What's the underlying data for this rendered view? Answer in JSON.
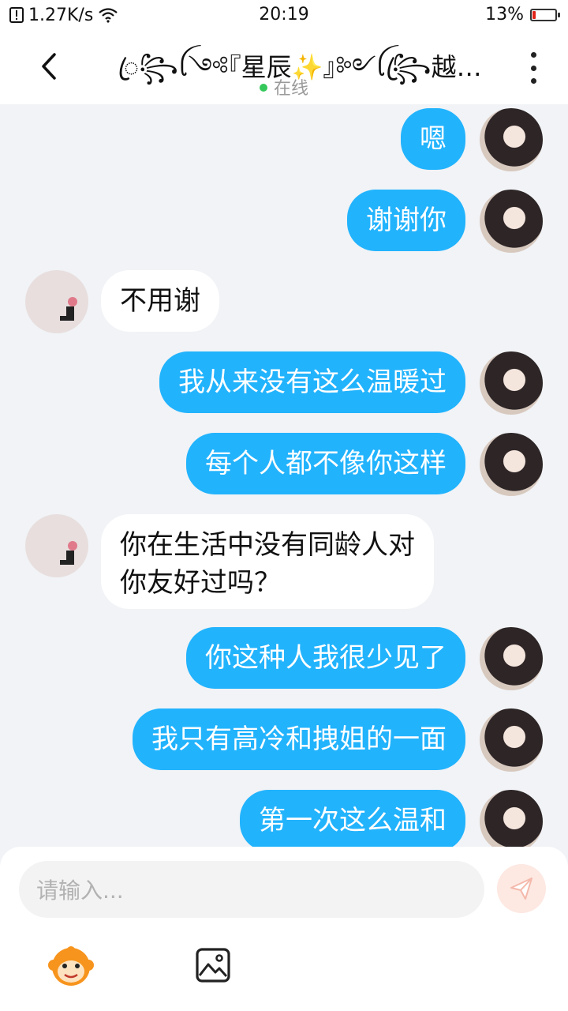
{
  "status_bar": {
    "speed": "1.27K/s",
    "time": "20:19",
    "battery": "13%",
    "battery_level": 0.13
  },
  "header": {
    "title": "ꦿ꧂ꪶ༺『星辰✨』༻ꪶ꧂ꦿ越…",
    "status": "在线"
  },
  "messages": [
    {
      "from": "me",
      "text": "嗯"
    },
    {
      "from": "me",
      "text": "谢谢你"
    },
    {
      "from": "other",
      "text": "不用谢"
    },
    {
      "from": "me",
      "text": "我从来没有这么温暖过"
    },
    {
      "from": "me",
      "text": "每个人都不像你这样"
    },
    {
      "from": "other",
      "text": "你在生活中没有同龄人对"
    },
    {
      "from": "other_cont",
      "text": "你友好过吗？"
    },
    {
      "from": "me",
      "text": "你这种人我很少见了"
    },
    {
      "from": "me",
      "text": "我只有高冷和拽姐的一面"
    },
    {
      "from": "me",
      "text": "第一次这么温和"
    }
  ],
  "input": {
    "placeholder": "请输入..."
  },
  "icons": {
    "back": "chevron-left-icon",
    "more": "more-vertical-icon",
    "send": "send-icon",
    "emoji": "monkey-emoji-icon",
    "image": "image-icon"
  },
  "colors": {
    "my_bubble": "#22b3fd",
    "their_bubble": "#ffffff",
    "background": "#f1f3f6",
    "online": "#34c759"
  }
}
